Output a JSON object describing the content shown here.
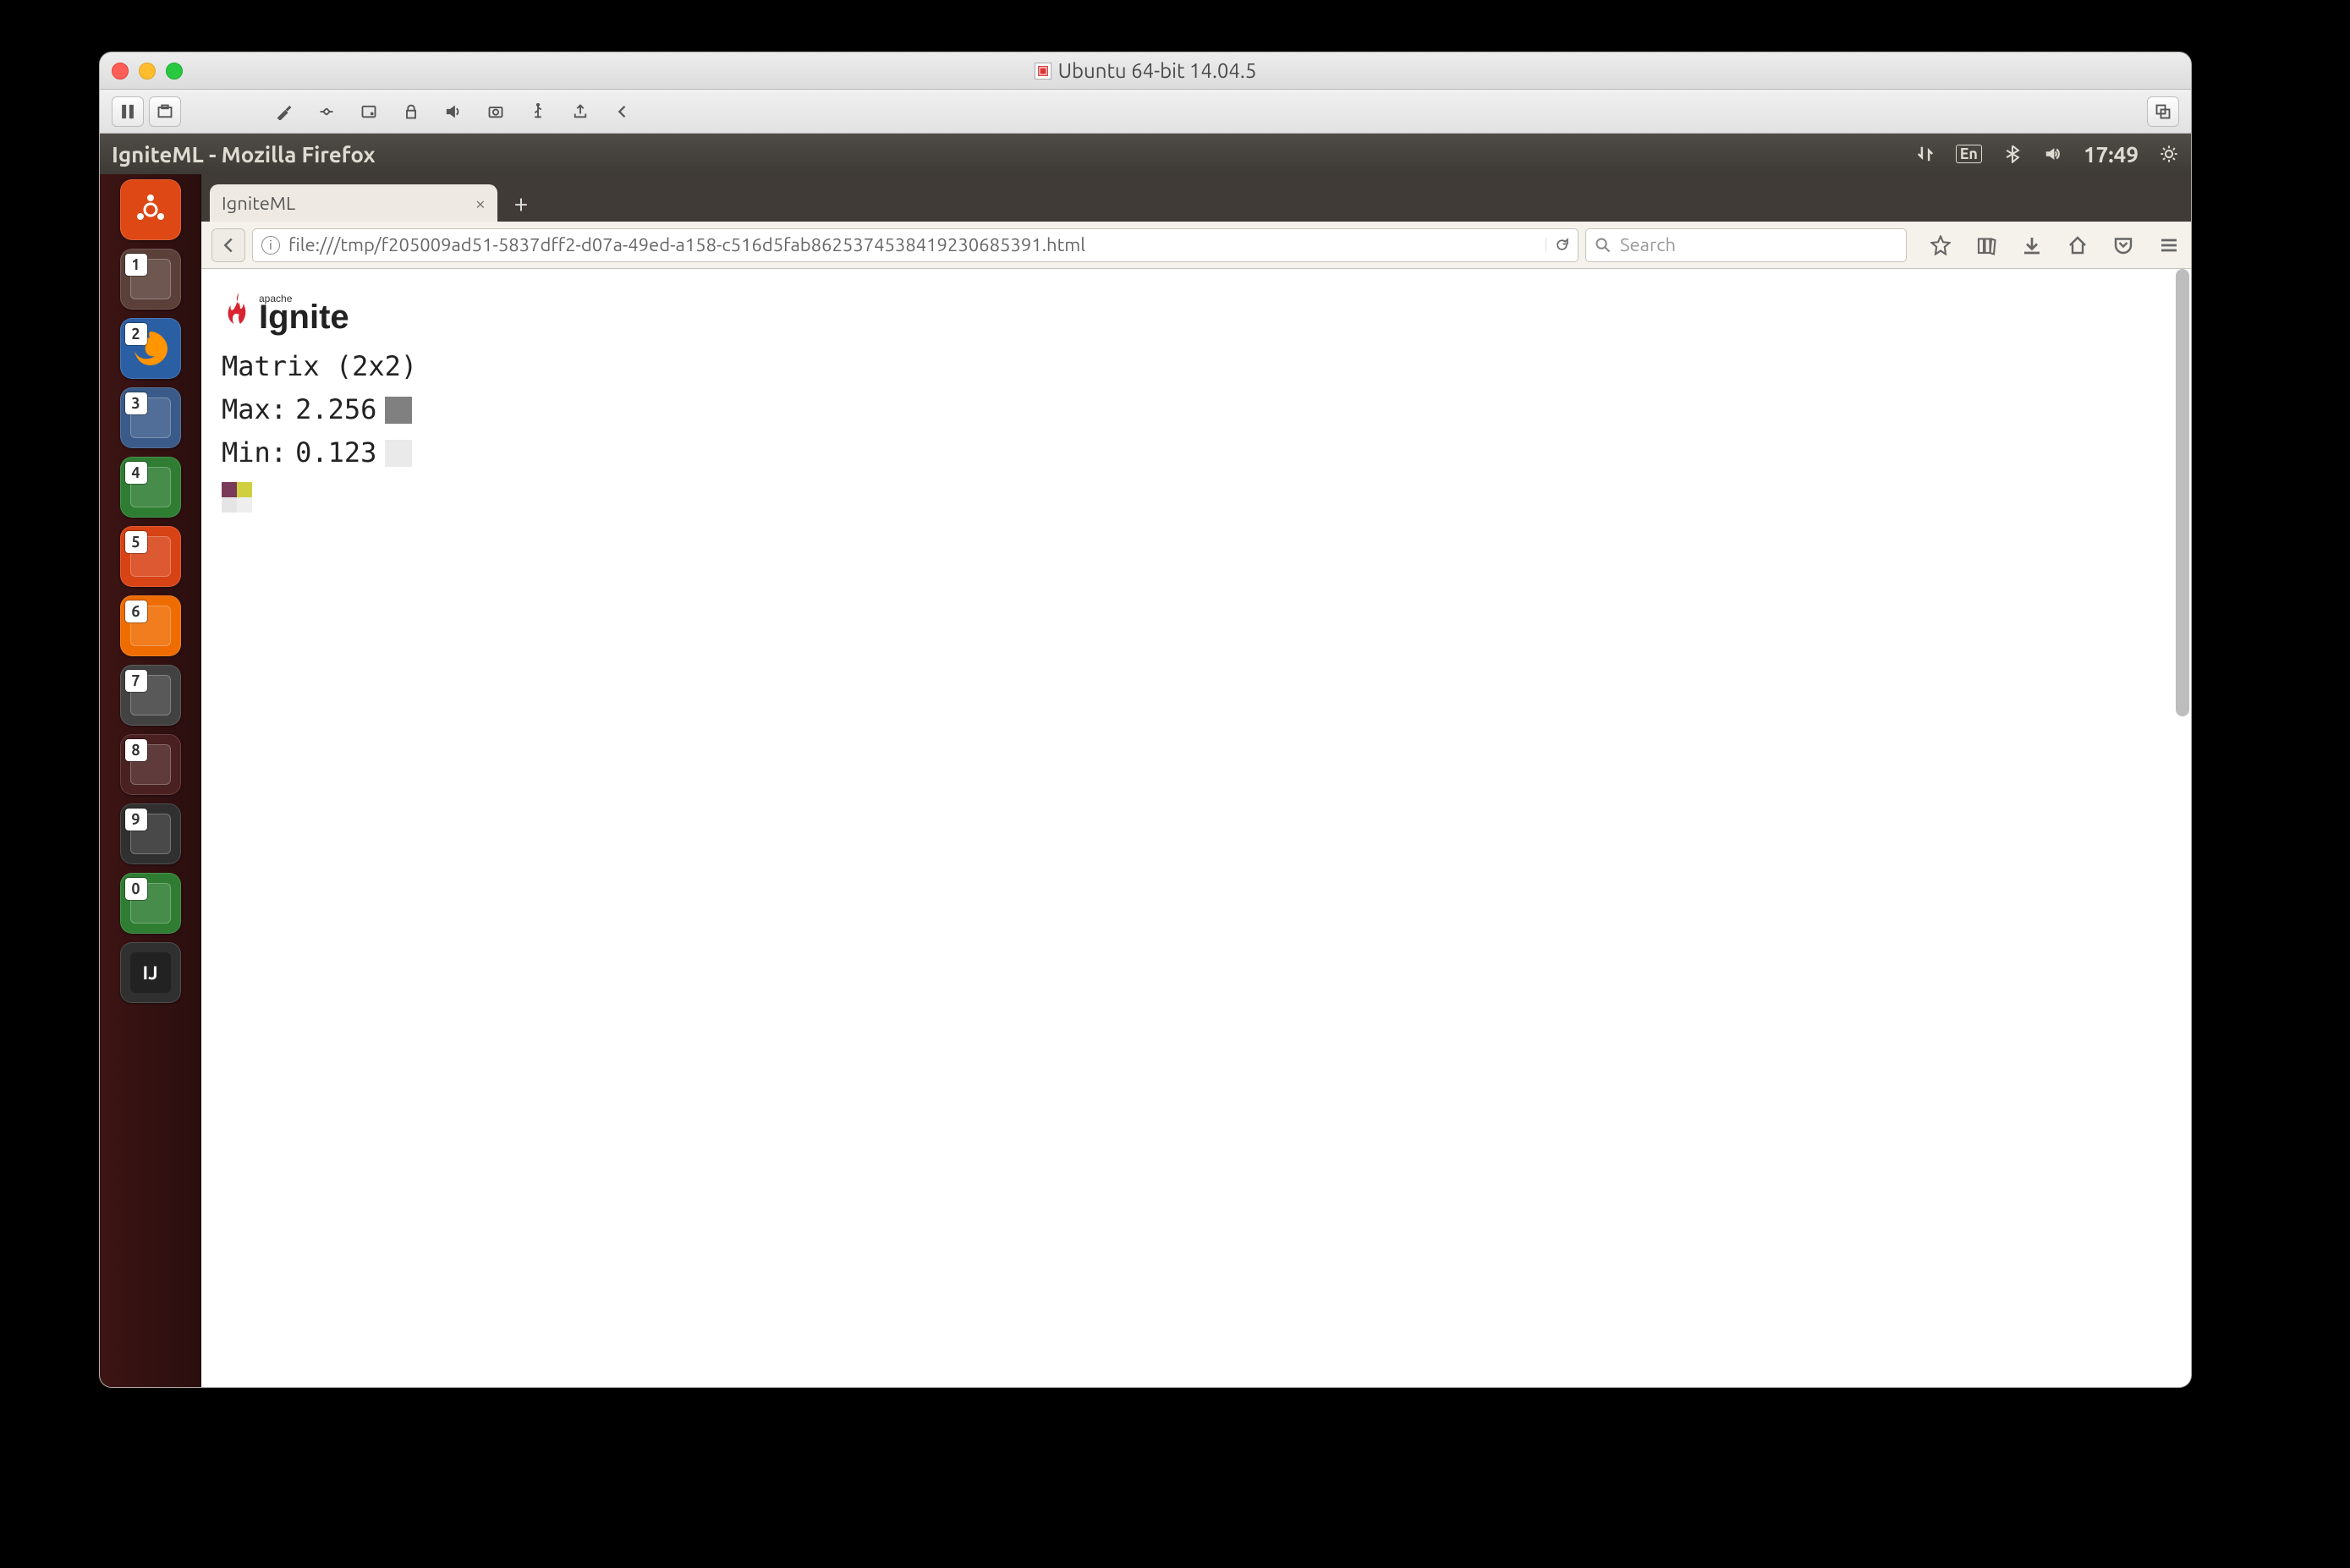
{
  "mac": {
    "title": "Ubuntu 64-bit 14.04.5"
  },
  "ubuntu_bar": {
    "window_title": "IgniteML - Mozilla Firefox",
    "lang": "En",
    "time": "17:49"
  },
  "launcher": {
    "items": [
      {
        "id": "dash",
        "bg": "#dd4814"
      },
      {
        "id": "app1",
        "bg": "#5a4038",
        "badge": "1"
      },
      {
        "id": "firefox",
        "bg": "#2b5fa4",
        "badge": "2"
      },
      {
        "id": "app3",
        "bg": "#3a5a8a",
        "badge": "3"
      },
      {
        "id": "app4",
        "bg": "#2e7d32",
        "badge": "4"
      },
      {
        "id": "app5",
        "bg": "#d84315",
        "badge": "5"
      },
      {
        "id": "app6",
        "bg": "#ef6c00",
        "badge": "6"
      },
      {
        "id": "app7",
        "bg": "#424242",
        "badge": "7"
      },
      {
        "id": "app8",
        "bg": "#4a2020",
        "badge": "8"
      },
      {
        "id": "app9",
        "bg": "#303030",
        "badge": "9"
      },
      {
        "id": "app0",
        "bg": "#2e7d32",
        "badge": "0"
      },
      {
        "id": "intellij",
        "bg": "#303030",
        "label": "IJ"
      }
    ]
  },
  "browser": {
    "tab_title": "IgniteML",
    "url": "file:///tmp/f205009ad51-5837dff2-d07a-49ed-a158-c516d5fab8625374538419230685391.html",
    "search_placeholder": "Search"
  },
  "page": {
    "logo_small": "apache",
    "logo_big": "Ignite",
    "heading": "Matrix (2x2)",
    "max_label": "Max:",
    "max_value": "2.256",
    "min_label": "Min:",
    "min_value": "0.123"
  }
}
